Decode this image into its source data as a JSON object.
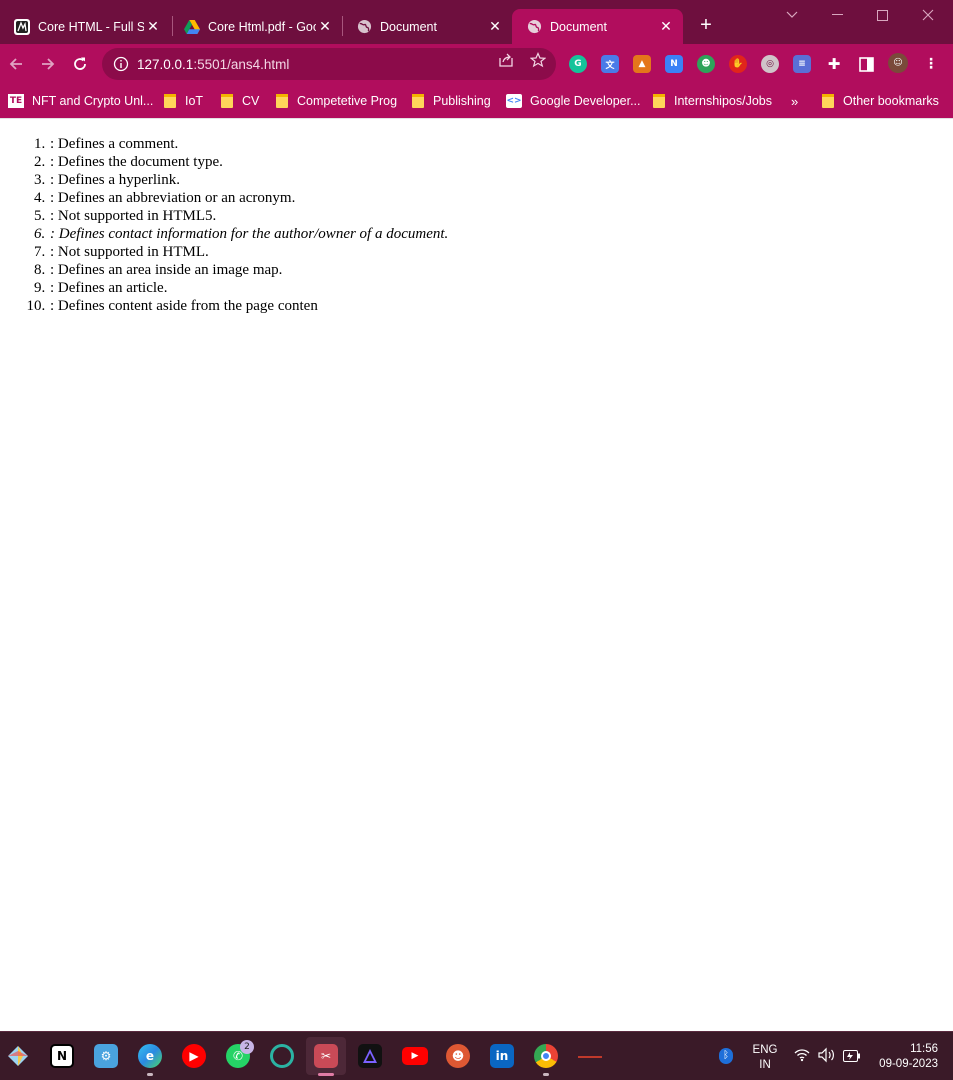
{
  "browser": {
    "tabs": [
      {
        "title": "Core HTML - Full St",
        "icon": "site-favicon",
        "active": false
      },
      {
        "title": "Core Html.pdf - Goo",
        "icon": "google-drive-icon",
        "active": false
      },
      {
        "title": "Document",
        "icon": "globe-icon",
        "active": false
      },
      {
        "title": "Document",
        "icon": "globe-icon",
        "active": true
      }
    ],
    "address": {
      "host": "127.0.0.1",
      "rest": ":5501/ans4.html"
    },
    "bookmarks": [
      {
        "label": "NFT and Crypto Unl...",
        "icon": "te-icon"
      },
      {
        "label": "IoT",
        "icon": "folder-icon"
      },
      {
        "label": "CV",
        "icon": "folder-icon"
      },
      {
        "label": "Competetive Prog",
        "icon": "folder-icon"
      },
      {
        "label": "Publishing",
        "icon": "folder-icon"
      },
      {
        "label": "Google Developer...",
        "icon": "google-dev-icon"
      },
      {
        "label": "Internshipos/Jobs",
        "icon": "folder-icon"
      }
    ],
    "bookmarks_overflow": "»",
    "other_bookmarks": "Other bookmarks",
    "colors": {
      "frame": "#6e0f3e",
      "toolbar": "#b10d5d",
      "omnibox": "#8c0b4a"
    }
  },
  "page": {
    "items": [
      {
        "text": ": Defines a comment.",
        "italic": false
      },
      {
        "text": ": Defines the document type.",
        "italic": false
      },
      {
        "text": ": Defines a hyperlink.",
        "italic": false
      },
      {
        "text": ": Defines an abbreviation or an acronym.",
        "italic": false
      },
      {
        "text": ": Not supported in HTML5.",
        "italic": false
      },
      {
        "text": ": Defines contact information for the author/owner of a document.",
        "italic": true
      },
      {
        "text": ": Not supported in HTML.",
        "italic": false
      },
      {
        "text": ": Defines an area inside an image map.",
        "italic": false
      },
      {
        "text": ": Defines an article.",
        "italic": false
      },
      {
        "text": ": Defines content aside from the page conten",
        "italic": false
      }
    ]
  },
  "taskbar": {
    "whatsapp_badge": "2",
    "language": "ENG",
    "region": "IN",
    "time": "11:56",
    "date": "09-09-2023"
  }
}
